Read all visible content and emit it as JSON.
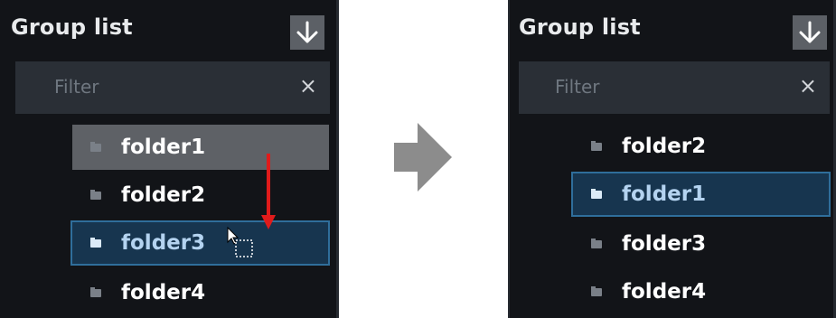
{
  "before": {
    "title": "Group list",
    "download_icon": "download-arrow-icon",
    "filter": {
      "placeholder": "Filter",
      "clear_glyph": "×"
    },
    "items": [
      {
        "label": "folder1",
        "state": "dragging"
      },
      {
        "label": "folder2",
        "state": "normal"
      },
      {
        "label": "folder3",
        "state": "selected"
      },
      {
        "label": "folder4",
        "state": "normal"
      }
    ]
  },
  "after": {
    "title": "Group list",
    "download_icon": "download-arrow-icon",
    "filter": {
      "placeholder": "Filter",
      "clear_glyph": "×"
    },
    "items": [
      {
        "label": "folder2",
        "state": "normal"
      },
      {
        "label": "folder1",
        "state": "selected"
      },
      {
        "label": "folder3",
        "state": "normal"
      },
      {
        "label": "folder4",
        "state": "normal"
      }
    ]
  },
  "colors": {
    "panel_bg": "#121418",
    "filter_bg": "#2a2f36",
    "drag_row_bg": "#5e6166",
    "selected_row_bg": "#17354f",
    "selected_border": "#2f6e9b",
    "drag_arrow": "#e01b1b",
    "transition_arrow": "#8c8c8c"
  }
}
